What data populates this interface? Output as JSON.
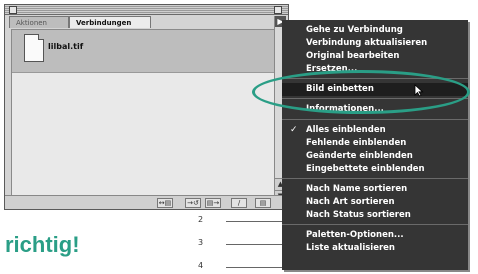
{
  "palette": {
    "tabs": [
      {
        "label": "Aktionen"
      },
      {
        "label": "Verbindungen"
      }
    ],
    "files": [
      {
        "name": "lilbal.tif"
      }
    ],
    "bottom_buttons": [
      "↔▤",
      "→↺",
      "▤→",
      "/",
      "▤"
    ]
  },
  "menu": {
    "items": [
      {
        "label": "Gehe zu Verbindung"
      },
      {
        "label": "Verbindung aktualisieren"
      },
      {
        "label": "Original bearbeiten"
      },
      {
        "label": "Ersetzen..."
      },
      {
        "label": "Bild einbetten"
      },
      {
        "label": "Informationen..."
      },
      {
        "label": "Alles einblenden"
      },
      {
        "label": "Fehlende einblenden"
      },
      {
        "label": "Geänderte einblenden"
      },
      {
        "label": "Eingebettete einblenden"
      },
      {
        "label": "Nach Name sortieren"
      },
      {
        "label": "Nach Art sortieren"
      },
      {
        "label": "Nach Status sortieren"
      },
      {
        "label": "Paletten-Optionen..."
      },
      {
        "label": "Liste aktualisieren"
      }
    ],
    "highlighted": "Bild einbetten",
    "checked": "Alles einblenden"
  },
  "annotation": {
    "label": "richtig!",
    "numbers": [
      "2",
      "3",
      "4"
    ],
    "color": "#2a9e86"
  }
}
